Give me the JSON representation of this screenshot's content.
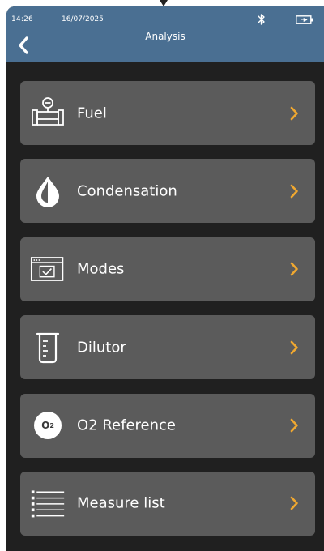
{
  "status_bar": {
    "time": "14:26",
    "date": "16/07/2025",
    "bluetooth_icon": "bluetooth-icon",
    "battery_icon": "battery-charging-icon"
  },
  "header": {
    "title": "Analysis",
    "back_icon": "chevron-left-icon"
  },
  "colors": {
    "header_bg": "#4a6f92",
    "screen_bg": "#202020",
    "item_bg": "#5b5b5b",
    "chevron": "#f0a830",
    "text": "#ffffff"
  },
  "menu": {
    "items": [
      {
        "label": "Fuel",
        "icon": "fuel-meter-icon"
      },
      {
        "label": "Condensation",
        "icon": "water-drop-icon"
      },
      {
        "label": "Modes",
        "icon": "window-check-icon"
      },
      {
        "label": "Dilutor",
        "icon": "beaker-icon"
      },
      {
        "label": "O2 Reference",
        "icon": "o2-icon",
        "badge_text": "O",
        "badge_sub": "2"
      },
      {
        "label": "Measure list",
        "icon": "list-icon"
      }
    ]
  }
}
